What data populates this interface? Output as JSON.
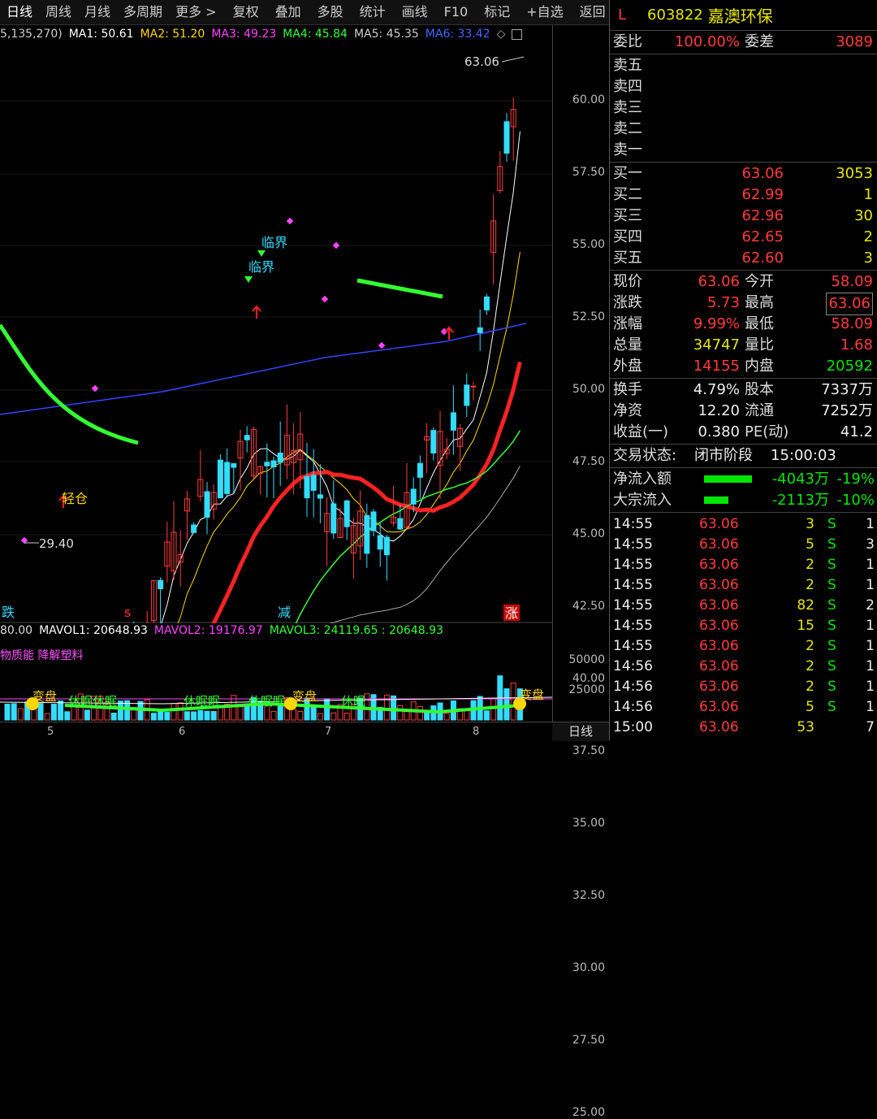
{
  "toolbar": {
    "items": [
      "日线",
      "周线",
      "月线",
      "多周期",
      "更多 >",
      "复权",
      "叠加",
      "多股",
      "统计",
      "画线",
      "F10",
      "标记",
      "+自选",
      "返回"
    ]
  },
  "ma_legend": {
    "params": "5,135,270)",
    "ma1": "MA1: 50.61",
    "ma2": "MA2: 51.20",
    "ma3": "MA3: 49.23",
    "ma4": "MA4: 45.84",
    "ma5": "MA5: 45.35",
    "ma6": "MA6: 33.42",
    "icon": "◇"
  },
  "chart_labels": {
    "high_label": "63.06",
    "low_label": "29.40",
    "light_position": "轻仓",
    "critical_1": "临界",
    "critical_2": "临界",
    "bottom_mark_1": "跌",
    "bottom_mark_2": "s",
    "bottom_mark_3": "减",
    "bottom_mark_4": "涨"
  },
  "y_ticks": [
    "60.00",
    "57.50",
    "55.00",
    "52.50",
    "50.00",
    "47.50",
    "45.00",
    "42.50",
    "40.00",
    "37.50",
    "35.00",
    "32.50",
    "30.00",
    "27.50",
    "25.00"
  ],
  "vol_ticks": [
    "50000",
    "25000"
  ],
  "vol_legend": {
    "prefix": "80.00",
    "mavol1": "MAVOL1: 20648.93",
    "mavol2": "MAVOL2: 19176.97",
    "mavol3": "MAVOL3: 24119.65 : 20648.93"
  },
  "indicator_name": "物质能 降解塑料",
  "vol_annotations": [
    "变盘",
    "休眠休眠",
    "休眠眠",
    "休眠眠",
    "变盘",
    "休眠",
    "变盘"
  ],
  "x_axis": [
    "5",
    "6",
    "7",
    "8"
  ],
  "period_label": "日线",
  "stock": {
    "mark": "L",
    "code": "603822",
    "name": "嘉澳环保"
  },
  "order_ratio": {
    "l1": "委比",
    "v1": "100.00%",
    "l2": "委差",
    "v2": "3089"
  },
  "asks": [
    {
      "label": "卖五"
    },
    {
      "label": "卖四"
    },
    {
      "label": "卖三"
    },
    {
      "label": "卖二"
    },
    {
      "label": "卖一"
    }
  ],
  "bids": [
    {
      "label": "买一",
      "price": "63.06",
      "vol": "3053"
    },
    {
      "label": "买二",
      "price": "62.99",
      "vol": "1"
    },
    {
      "label": "买三",
      "price": "62.96",
      "vol": "30"
    },
    {
      "label": "买四",
      "price": "62.65",
      "vol": "2"
    },
    {
      "label": "买五",
      "price": "62.60",
      "vol": "3"
    }
  ],
  "quote": [
    {
      "l1": "现价",
      "v1": "63.06",
      "l2": "今开",
      "v2": "58.09"
    },
    {
      "l1": "涨跌",
      "v1": "5.73",
      "l2": "最高",
      "v2": "63.06"
    },
    {
      "l1": "涨幅",
      "v1": "9.99%",
      "l2": "最低",
      "v2": "58.09"
    },
    {
      "l1": "总量",
      "v1": "34747",
      "l2": "量比",
      "v2": "1.68"
    },
    {
      "l1": "外盘",
      "v1": "14155",
      "l2": "内盘",
      "v2": "20592"
    }
  ],
  "fundamentals": [
    {
      "l1": "换手",
      "v1": "4.79%",
      "l2": "股本",
      "v2": "7337万"
    },
    {
      "l1": "净资",
      "v1": "12.20",
      "l2": "流通",
      "v2": "7252万"
    },
    {
      "l1": "收益(一)",
      "v1": "0.380",
      "l2": "PE(动)",
      "v2": "41.2"
    }
  ],
  "trade_status": {
    "label": "交易状态:",
    "value": "闭市阶段",
    "time": "15:00:03"
  },
  "flows": [
    {
      "label": "净流入额",
      "value": "-4043万",
      "pct": "-19%",
      "bar": 0.9
    },
    {
      "label": "大宗流入",
      "value": "-2113万",
      "pct": "-10%",
      "bar": 0.45
    }
  ],
  "ticks": [
    {
      "t": "14:55",
      "p": "63.06",
      "v": "3",
      "s": "S",
      "n": "1"
    },
    {
      "t": "14:55",
      "p": "63.06",
      "v": "5",
      "s": "S",
      "n": "3"
    },
    {
      "t": "14:55",
      "p": "63.06",
      "v": "2",
      "s": "S",
      "n": "1"
    },
    {
      "t": "14:55",
      "p": "63.06",
      "v": "2",
      "s": "S",
      "n": "1"
    },
    {
      "t": "14:55",
      "p": "63.06",
      "v": "82",
      "s": "S",
      "n": "2"
    },
    {
      "t": "14:55",
      "p": "63.06",
      "v": "15",
      "s": "S",
      "n": "1"
    },
    {
      "t": "14:55",
      "p": "63.06",
      "v": "2",
      "s": "S",
      "n": "1"
    },
    {
      "t": "14:56",
      "p": "63.06",
      "v": "2",
      "s": "S",
      "n": "1"
    },
    {
      "t": "14:56",
      "p": "63.06",
      "v": "2",
      "s": "S",
      "n": "1"
    },
    {
      "t": "14:56",
      "p": "63.06",
      "v": "5",
      "s": "S",
      "n": "1"
    },
    {
      "t": "15:00",
      "p": "63.06",
      "v": "53",
      "s": "",
      "n": "7"
    }
  ]
}
